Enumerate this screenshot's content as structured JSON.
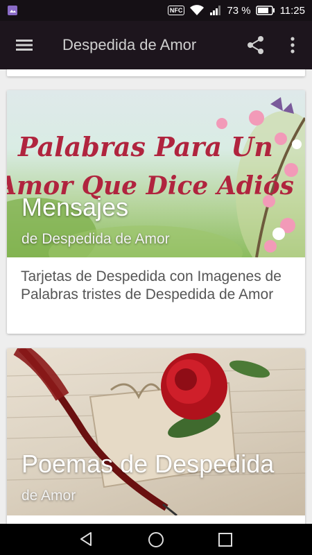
{
  "status_bar": {
    "nfc_label": "NFC",
    "battery_text": "73 %",
    "time": "11:25"
  },
  "app_bar": {
    "title": "Despedida de Amor"
  },
  "cards": [
    {
      "image_text_line1": "Palabras Para Un",
      "image_text_line2": "Amor Que Dice Adiós",
      "title": "Mensajes",
      "subtitle": "de Despedida de Amor",
      "description": "Tarjetas de Despedida con Imagenes de Palabras tristes de Despedida de Amor"
    },
    {
      "title": "Poemas de Despedida",
      "subtitle": "de Amor"
    }
  ],
  "colors": {
    "status_bar": "#151015",
    "app_bar": "#1d151d",
    "background": "#eeeeee",
    "image_script_text": "#b0243e"
  }
}
